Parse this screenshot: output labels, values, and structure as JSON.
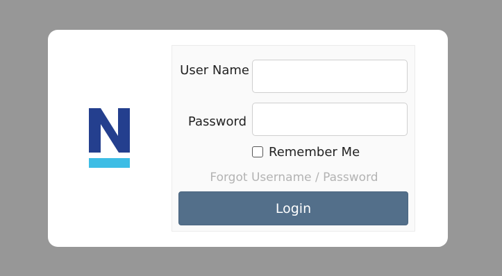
{
  "logo": {
    "icon": "brand-n-logo",
    "letter_color": "#243f8e",
    "bar_color": "#3dbde5"
  },
  "login_form": {
    "username_label": "User Name",
    "password_label": "Password",
    "username_value": "",
    "password_value": "",
    "remember_label": "Remember Me",
    "remember_checked": false,
    "forgot_link": "Forgot Username / Password",
    "login_button": "Login"
  },
  "colors": {
    "backdrop": "#979797",
    "button": "#536f8a",
    "link": "#b3b3b3"
  }
}
